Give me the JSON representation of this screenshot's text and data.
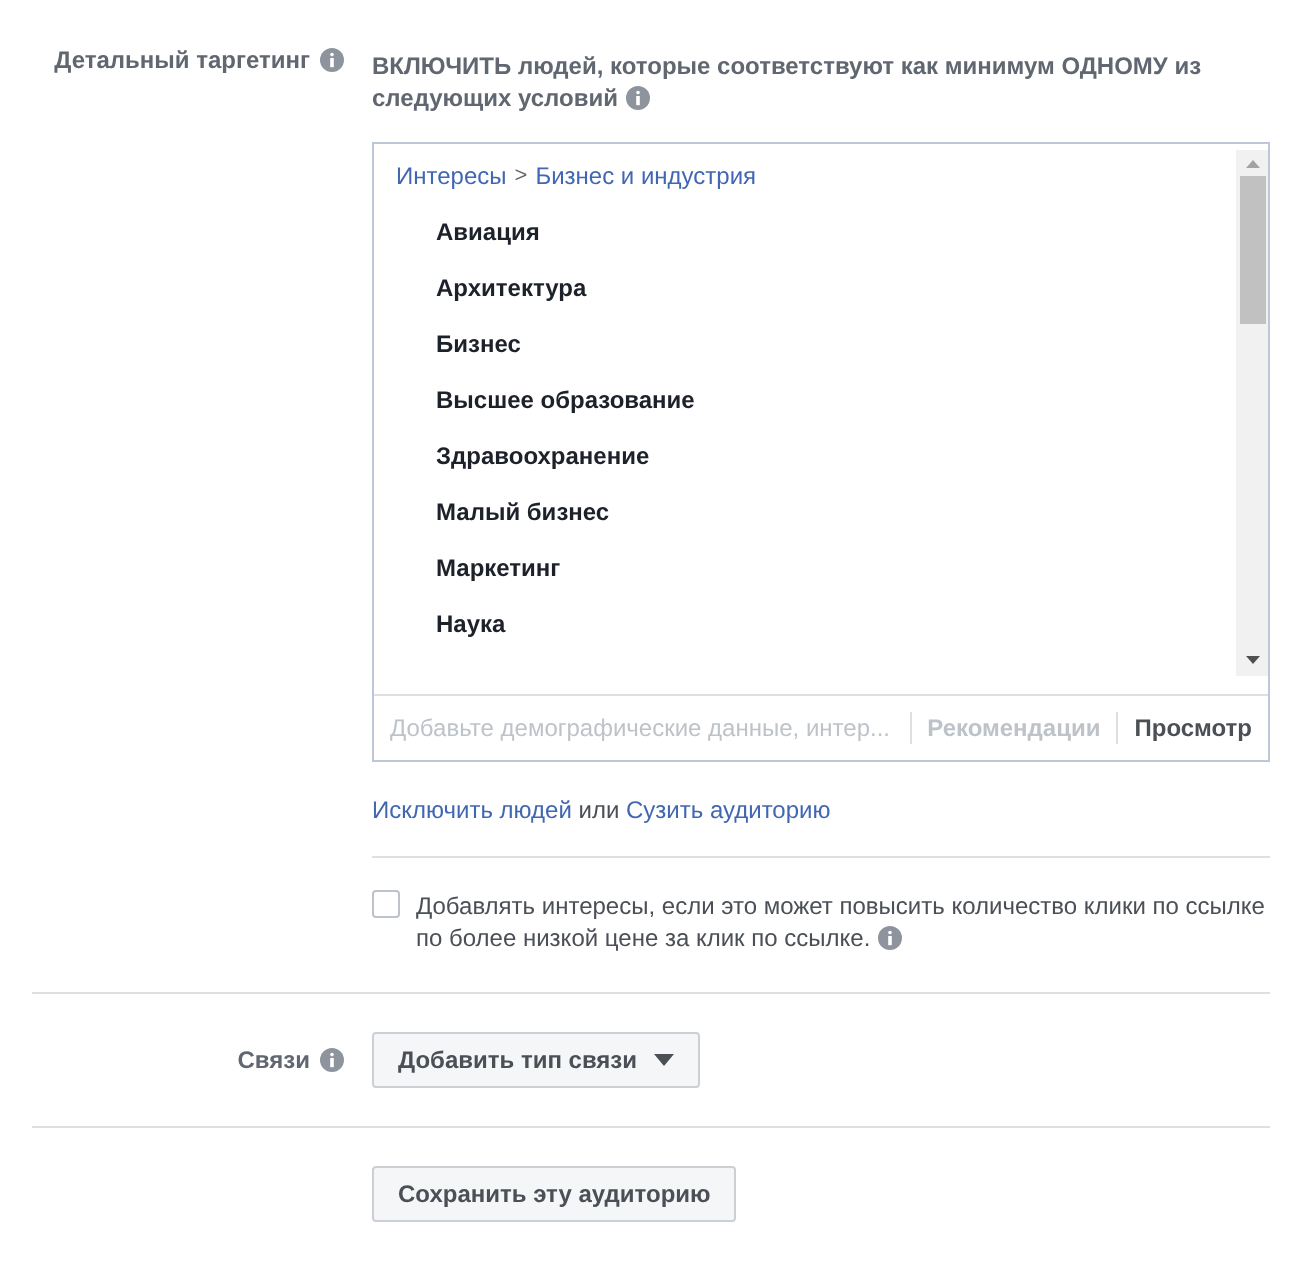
{
  "detailed_targeting": {
    "label": "Детальный таргетинг",
    "title": "ВКЛЮЧИТЬ людей, которые соответствуют как минимум ОДНОМУ из следующих условий",
    "browser": {
      "breadcrumb": [
        "Интересы",
        "Бизнес и индустрия"
      ],
      "separator": ">",
      "options": [
        "Авиация",
        "Архитектура",
        "Бизнес",
        "Высшее образование",
        "Здравоохранение",
        "Малый бизнес",
        "Маркетинг",
        "Наука"
      ]
    },
    "search": {
      "placeholder": "Добавьте демографические данные, интер..."
    },
    "modes": [
      {
        "label": "Рекомендации",
        "disabled": true
      },
      {
        "label": "Просмотр",
        "disabled": false
      }
    ],
    "actions": [
      {
        "kind": "link",
        "text": "Исключить людей"
      },
      {
        "kind": "text",
        "text": "или"
      },
      {
        "kind": "link",
        "text": "Сузить аудиторию"
      }
    ],
    "expand_interests": {
      "label": "Добавлять интересы, если это может повысить количество клики по ссылке по более низкой цене за клик по ссылке.",
      "checked": false
    }
  },
  "connections": {
    "label": "Связи",
    "button": "Добавить тип связи"
  },
  "save_button": "Сохранить эту аудиторию"
}
